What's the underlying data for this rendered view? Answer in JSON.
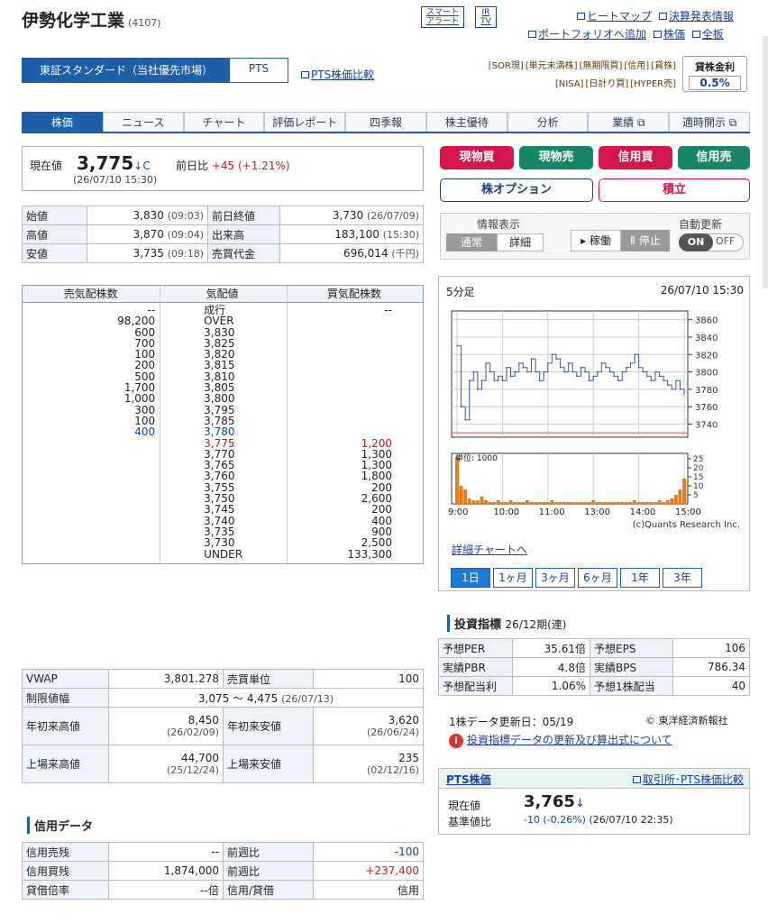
{
  "header": {
    "company": "伊勢化学工業",
    "code": "(4107)",
    "smart_alert_1": "スマート",
    "smart_alert_2": "アラート",
    "ir_1": "IR",
    "ir_2": "TV",
    "link_heatmap": "ヒートマップ",
    "link_kessan": "決算発表情報",
    "link_portfolio": "ポートフォリオへ追加",
    "link_kabuka": "株価",
    "link_zenban": "全板"
  },
  "market": {
    "primary": "東証スタンダード（当社優先市場）",
    "pts": "PTS",
    "pts_compare": "PTS株価比較",
    "tags_row1": [
      "[SOR現]",
      "[単元未満株]",
      "[無期限買]",
      "[信用]",
      "[貸株]"
    ],
    "tags_row2": [
      "[NISA]",
      "[日計り買]",
      "[HYPER売]"
    ],
    "rate_label": "貸株金利",
    "rate_value": "0.5%"
  },
  "nav": {
    "tabs": [
      "株価",
      "ニュース",
      "チャート",
      "評価レポート",
      "四季報",
      "株主優待",
      "分析",
      "業績 ⧉",
      "適時開示 ⧉"
    ]
  },
  "current": {
    "label": "現在値",
    "price": "3,775",
    "arrow": "↓C",
    "diff_label": "前日比",
    "diff_value": "+45",
    "diff_pct": "(+1.21%)",
    "timestamp": "(26/07/10 15:30)"
  },
  "ohlc": {
    "rows": [
      {
        "l1": "始値",
        "v1": "3,830",
        "t1": "(09:03)",
        "l2": "前日終値",
        "v2": "3,730",
        "t2": "(26/07/09)"
      },
      {
        "l1": "高値",
        "v1": "3,870",
        "t1": "(09:04)",
        "l2": "出来高",
        "v2": "183,100",
        "t2": "(15:30)"
      },
      {
        "l1": "安値",
        "v1": "3,735",
        "t1": "(09:18)",
        "l2": "売買代金",
        "v2": "696,014",
        "t2": "(千円)"
      }
    ]
  },
  "book": {
    "headers": [
      "売気配株数",
      "気配値",
      "買気配株数"
    ],
    "rows": [
      {
        "sell": "--",
        "price": "成行",
        "buy": "--",
        "pc": ""
      },
      {
        "sell": "98,200",
        "price": "OVER",
        "buy": "",
        "pc": ""
      },
      {
        "sell": "600",
        "price": "3,830",
        "buy": "",
        "pc": ""
      },
      {
        "sell": "700",
        "price": "3,825",
        "buy": "",
        "pc": ""
      },
      {
        "sell": "100",
        "price": "3,820",
        "buy": "",
        "pc": ""
      },
      {
        "sell": "200",
        "price": "3,815",
        "buy": "",
        "pc": ""
      },
      {
        "sell": "500",
        "price": "3,810",
        "buy": "",
        "pc": ""
      },
      {
        "sell": "1,700",
        "price": "3,805",
        "buy": "",
        "pc": ""
      },
      {
        "sell": "1,000",
        "price": "3,800",
        "buy": "",
        "pc": ""
      },
      {
        "sell": "300",
        "price": "3,795",
        "buy": "",
        "pc": ""
      },
      {
        "sell": "100",
        "price": "3,785",
        "buy": "",
        "pc": ""
      },
      {
        "sell": "400",
        "price": "3,780",
        "buy": "",
        "pc": "blue",
        "sc": "blue"
      },
      {
        "sell": "",
        "price": "3,775",
        "buy": "1,200",
        "pc": "red",
        "bc": "red"
      },
      {
        "sell": "",
        "price": "3,770",
        "buy": "1,300",
        "pc": ""
      },
      {
        "sell": "",
        "price": "3,765",
        "buy": "1,300",
        "pc": ""
      },
      {
        "sell": "",
        "price": "3,760",
        "buy": "1,800",
        "pc": ""
      },
      {
        "sell": "",
        "price": "3,755",
        "buy": "200",
        "pc": ""
      },
      {
        "sell": "",
        "price": "3,750",
        "buy": "2,600",
        "pc": ""
      },
      {
        "sell": "",
        "price": "3,745",
        "buy": "200",
        "pc": ""
      },
      {
        "sell": "",
        "price": "3,740",
        "buy": "400",
        "pc": ""
      },
      {
        "sell": "",
        "price": "3,735",
        "buy": "900",
        "pc": ""
      },
      {
        "sell": "",
        "price": "3,730",
        "buy": "2,500",
        "pc": ""
      },
      {
        "sell": "",
        "price": "UNDER",
        "buy": "133,300",
        "pc": ""
      }
    ]
  },
  "stats": {
    "vwap_label": "VWAP",
    "vwap": "3,801.278",
    "unit_label": "売買単位",
    "unit": "100",
    "limit_label": "制限値幅",
    "limit": "3,075 〜 4,475",
    "limit_date": "(26/07/13)",
    "ytd_high_label": "年初来高値",
    "ytd_high": "8,450",
    "ytd_high_date": "(26/02/09)",
    "ytd_low_label": "年初来安値",
    "ytd_low": "3,620",
    "ytd_low_date": "(26/06/24)",
    "all_high_label": "上場来高値",
    "all_high": "44,700",
    "all_high_date": "(25/12/24)",
    "all_low_label": "上場来安値",
    "all_low": "235",
    "all_low_date": "(02/12/16)"
  },
  "credit": {
    "title": "信用データ",
    "rows": [
      {
        "l1": "信用売残",
        "v1": "--",
        "l2": "前週比",
        "v2": "-100",
        "c": "blue"
      },
      {
        "l1": "信用買残",
        "v1": "1,874,000",
        "l2": "前週比",
        "v2": "+237,400",
        "c": "red"
      },
      {
        "l1": "貸借倍率",
        "v1": "--倍",
        "l2": "信用/貸借",
        "v2": "信用",
        "c": ""
      }
    ]
  },
  "trade": {
    "genbutsu_buy": "現物買",
    "genbutsu_sell": "現物売",
    "shinyo_buy": "信用買",
    "shinyo_sell": "信用売",
    "option": "株オプション",
    "tsumitate": "積立",
    "info_label": "情報表示",
    "normal": "通常",
    "detail": "詳細",
    "auto_label": "自動更新",
    "run": "▸ 稼働",
    "stop": "Ⅱ 停止",
    "on": "ON",
    "off": "OFF"
  },
  "chart_header": {
    "interval": "5分足",
    "datetime": "26/07/10 15:30",
    "unit": "単位: 1000",
    "credit": "(c)Quants Research Inc.",
    "detail_link": "詳細チャートへ"
  },
  "chart_data": {
    "type": "candlestick-with-volume",
    "x_ticks": [
      "9:00",
      "10:00",
      "11:00",
      "13:00",
      "14:00",
      "15:00"
    ],
    "ylim": [
      3725,
      3870
    ],
    "y_ticks": [
      3860,
      3840,
      3820,
      3800,
      3780,
      3760,
      3740
    ],
    "prev_close": 3730,
    "closes": [
      3830,
      3760,
      3745,
      3790,
      3800,
      3780,
      3790,
      3810,
      3800,
      3790,
      3795,
      3790,
      3805,
      3795,
      3800,
      3810,
      3805,
      3800,
      3815,
      3800,
      3790,
      3800,
      3810,
      3820,
      3815,
      3805,
      3800,
      3810,
      3800,
      3795,
      3805,
      3800,
      3790,
      3795,
      3800,
      3810,
      3805,
      3800,
      3795,
      3790,
      3800,
      3805,
      3810,
      3820,
      3805,
      3800,
      3795,
      3790,
      3800,
      3795,
      3790,
      3785,
      3780,
      3790,
      3780,
      3775
    ],
    "volume_ylim": [
      0,
      28
    ],
    "volume_ticks": [
      25,
      20,
      15,
      10,
      5
    ],
    "volumes": [
      26,
      10,
      8,
      3,
      2,
      2,
      4,
      2,
      1,
      1,
      2,
      1,
      1,
      2,
      1,
      1,
      1,
      2,
      1,
      1,
      1,
      1,
      1,
      2,
      1,
      1,
      1,
      1,
      1,
      1,
      1,
      1,
      1,
      2,
      1,
      1,
      1,
      1,
      1,
      1,
      1,
      1,
      1,
      2,
      1,
      1,
      1,
      1,
      1,
      2,
      1,
      2,
      3,
      5,
      8,
      14
    ]
  },
  "periods": [
    "1日",
    "1ヶ月",
    "3ヶ月",
    "6ヶ月",
    "1年",
    "3年"
  ],
  "indicators": {
    "title": "投資指標",
    "period": "26/12期(連)",
    "rows": [
      {
        "l1": "予想PER",
        "v1": "35.61倍",
        "l2": "予想EPS",
        "v2": "106"
      },
      {
        "l1": "実績PBR",
        "v1": "4.8倍",
        "l2": "実績BPS",
        "v2": "786.34"
      },
      {
        "l1": "予想配当利",
        "v1": "1.06%",
        "l2": "予想1株配当",
        "v2": "40"
      }
    ],
    "update": "1株データ更新日：05/19",
    "source": "© 東洋経済新報社",
    "note_link": "投資指標データの更新及び算出式について"
  },
  "pts": {
    "title": "PTS株価",
    "compare": "取引所･PTS株価比較",
    "cur_label": "現在値",
    "price": "3,765",
    "arrow": "↓",
    "base_label": "基準値比",
    "diff": "-10 (-0.26%)",
    "ts": "(26/07/10 22:35)"
  }
}
